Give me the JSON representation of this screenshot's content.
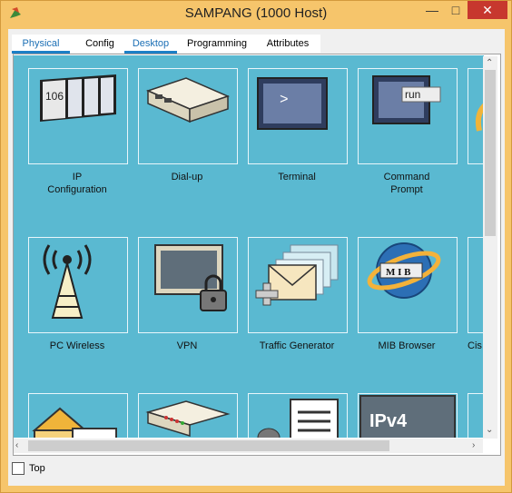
{
  "window": {
    "title": "SAMPANG (1000 Host)"
  },
  "tabs": [
    {
      "label": "Physical",
      "selected": true
    },
    {
      "label": "Config",
      "selected": false
    },
    {
      "label": "Desktop",
      "selected": true
    },
    {
      "label": "Programming",
      "selected": false
    },
    {
      "label": "Attributes",
      "selected": false
    }
  ],
  "desktop_apps": [
    {
      "label": "IP\nConfiguration",
      "icon": "ip-configuration-icon"
    },
    {
      "label": "Dial-up",
      "icon": "modem-icon"
    },
    {
      "label": "Terminal",
      "icon": "terminal-icon"
    },
    {
      "label": "Command\nPrompt",
      "icon": "command-prompt-icon"
    },
    {
      "label": "PC Wireless",
      "icon": "wireless-tower-icon"
    },
    {
      "label": "VPN",
      "icon": "vpn-lock-icon"
    },
    {
      "label": "Traffic Generator",
      "icon": "traffic-generator-icon"
    },
    {
      "label": "MIB Browser",
      "icon": "mib-browser-icon"
    },
    {
      "label": "Cis",
      "icon": "partial-app-icon"
    }
  ],
  "icon_text": {
    "ip_number": "106",
    "run": "run",
    "mib": "M I B",
    "ipv4": "IPv4"
  },
  "footer": {
    "top_label": "Top",
    "top_checked": false
  },
  "colors": {
    "accent": "#1b7fc6",
    "panel": "#5ab9d1",
    "titlebar": "#f6c56b",
    "close": "#c7372e"
  }
}
